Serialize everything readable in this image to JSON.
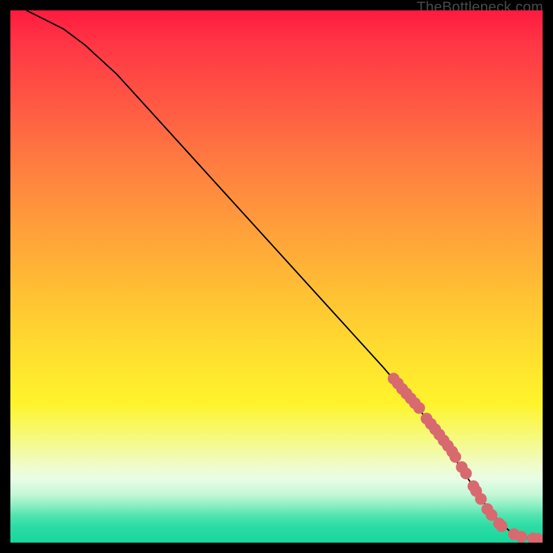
{
  "watermark": "TheBottleneck.com",
  "colors": {
    "background": "#000000",
    "curve_stroke": "#000000",
    "marker_fill": "#d86a6f",
    "marker_stroke": "#cc565a",
    "gradient_top": "#ff1a3f",
    "gradient_bottom": "#16d79c"
  },
  "chart_data": {
    "type": "line",
    "title": "",
    "xlabel": "",
    "ylabel": "",
    "xlim": [
      0,
      100
    ],
    "ylim": [
      0,
      100
    ],
    "series": [
      {
        "name": "curve",
        "x": [
          3,
          6,
          10,
          14,
          20,
          30,
          40,
          50,
          60,
          70,
          76,
          80,
          84,
          86,
          88,
          90,
          92,
          94,
          96,
          98,
          100
        ],
        "y": [
          100,
          98.5,
          96.5,
          93.5,
          88,
          77,
          66,
          55,
          44,
          33,
          26,
          21,
          15,
          12,
          9,
          6,
          3.8,
          2.0,
          1.1,
          0.8,
          0.7
        ]
      }
    ],
    "markers": {
      "name": "highlighted-points",
      "x": [
        72.0,
        72.8,
        73.6,
        74.4,
        75.2,
        76.0,
        76.8,
        78.2,
        79.0,
        79.8,
        80.6,
        81.4,
        82.2,
        83.0,
        83.6,
        84.8,
        85.6,
        87.0,
        87.5,
        88.4,
        89.6,
        90.4,
        91.8,
        92.3,
        94.6,
        96.0,
        98.2,
        99.1
      ],
      "y": [
        30.8,
        29.9,
        28.9,
        28.0,
        27.1,
        26.2,
        25.3,
        23.3,
        22.3,
        21.3,
        20.3,
        19.2,
        18.2,
        17.1,
        16.1,
        14.2,
        13.0,
        10.6,
        9.7,
        8.2,
        6.3,
        5.2,
        3.6,
        3.1,
        1.6,
        1.1,
        0.8,
        0.7
      ]
    }
  }
}
